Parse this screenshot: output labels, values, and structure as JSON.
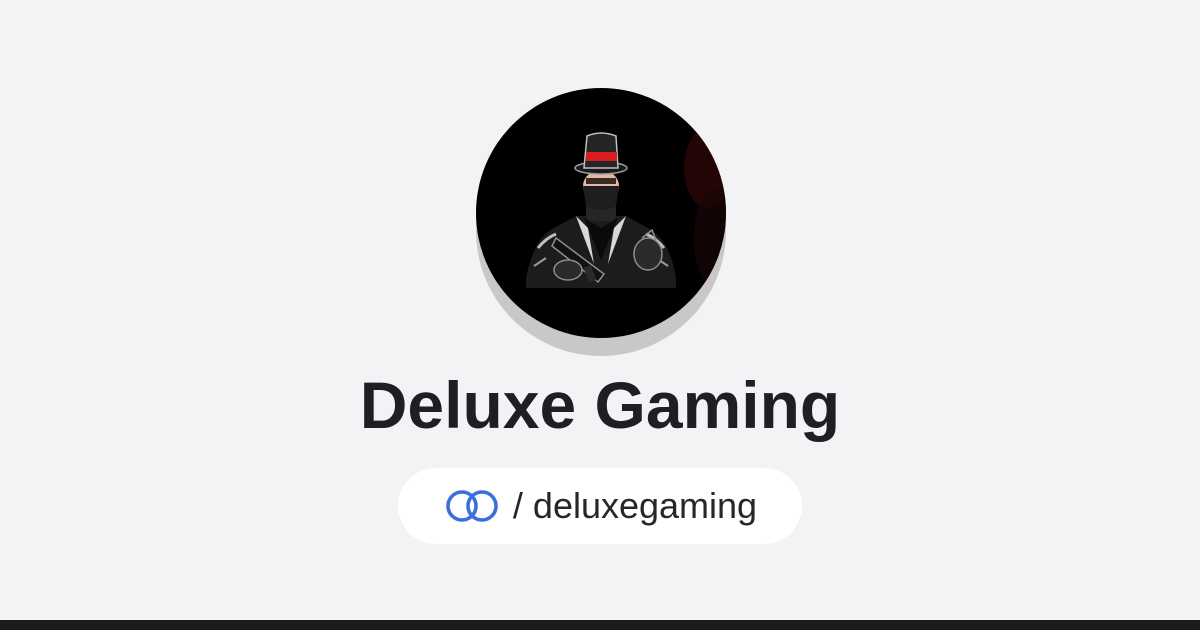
{
  "profile": {
    "name": "Deluxe Gaming",
    "handle_separator": "/",
    "handle": "deluxegaming",
    "avatar_icon": "masked-gangster-avatar",
    "link_icon": "linktree-rings-icon"
  },
  "colors": {
    "background": "#f3f3f5",
    "title": "#1e1f22",
    "pill_background": "#ffffff",
    "link_icon": "#3b6fd9",
    "bottom_bar": "#1b1b1d",
    "avatar_background": "#000000",
    "hat_band": "#d81e1e"
  }
}
